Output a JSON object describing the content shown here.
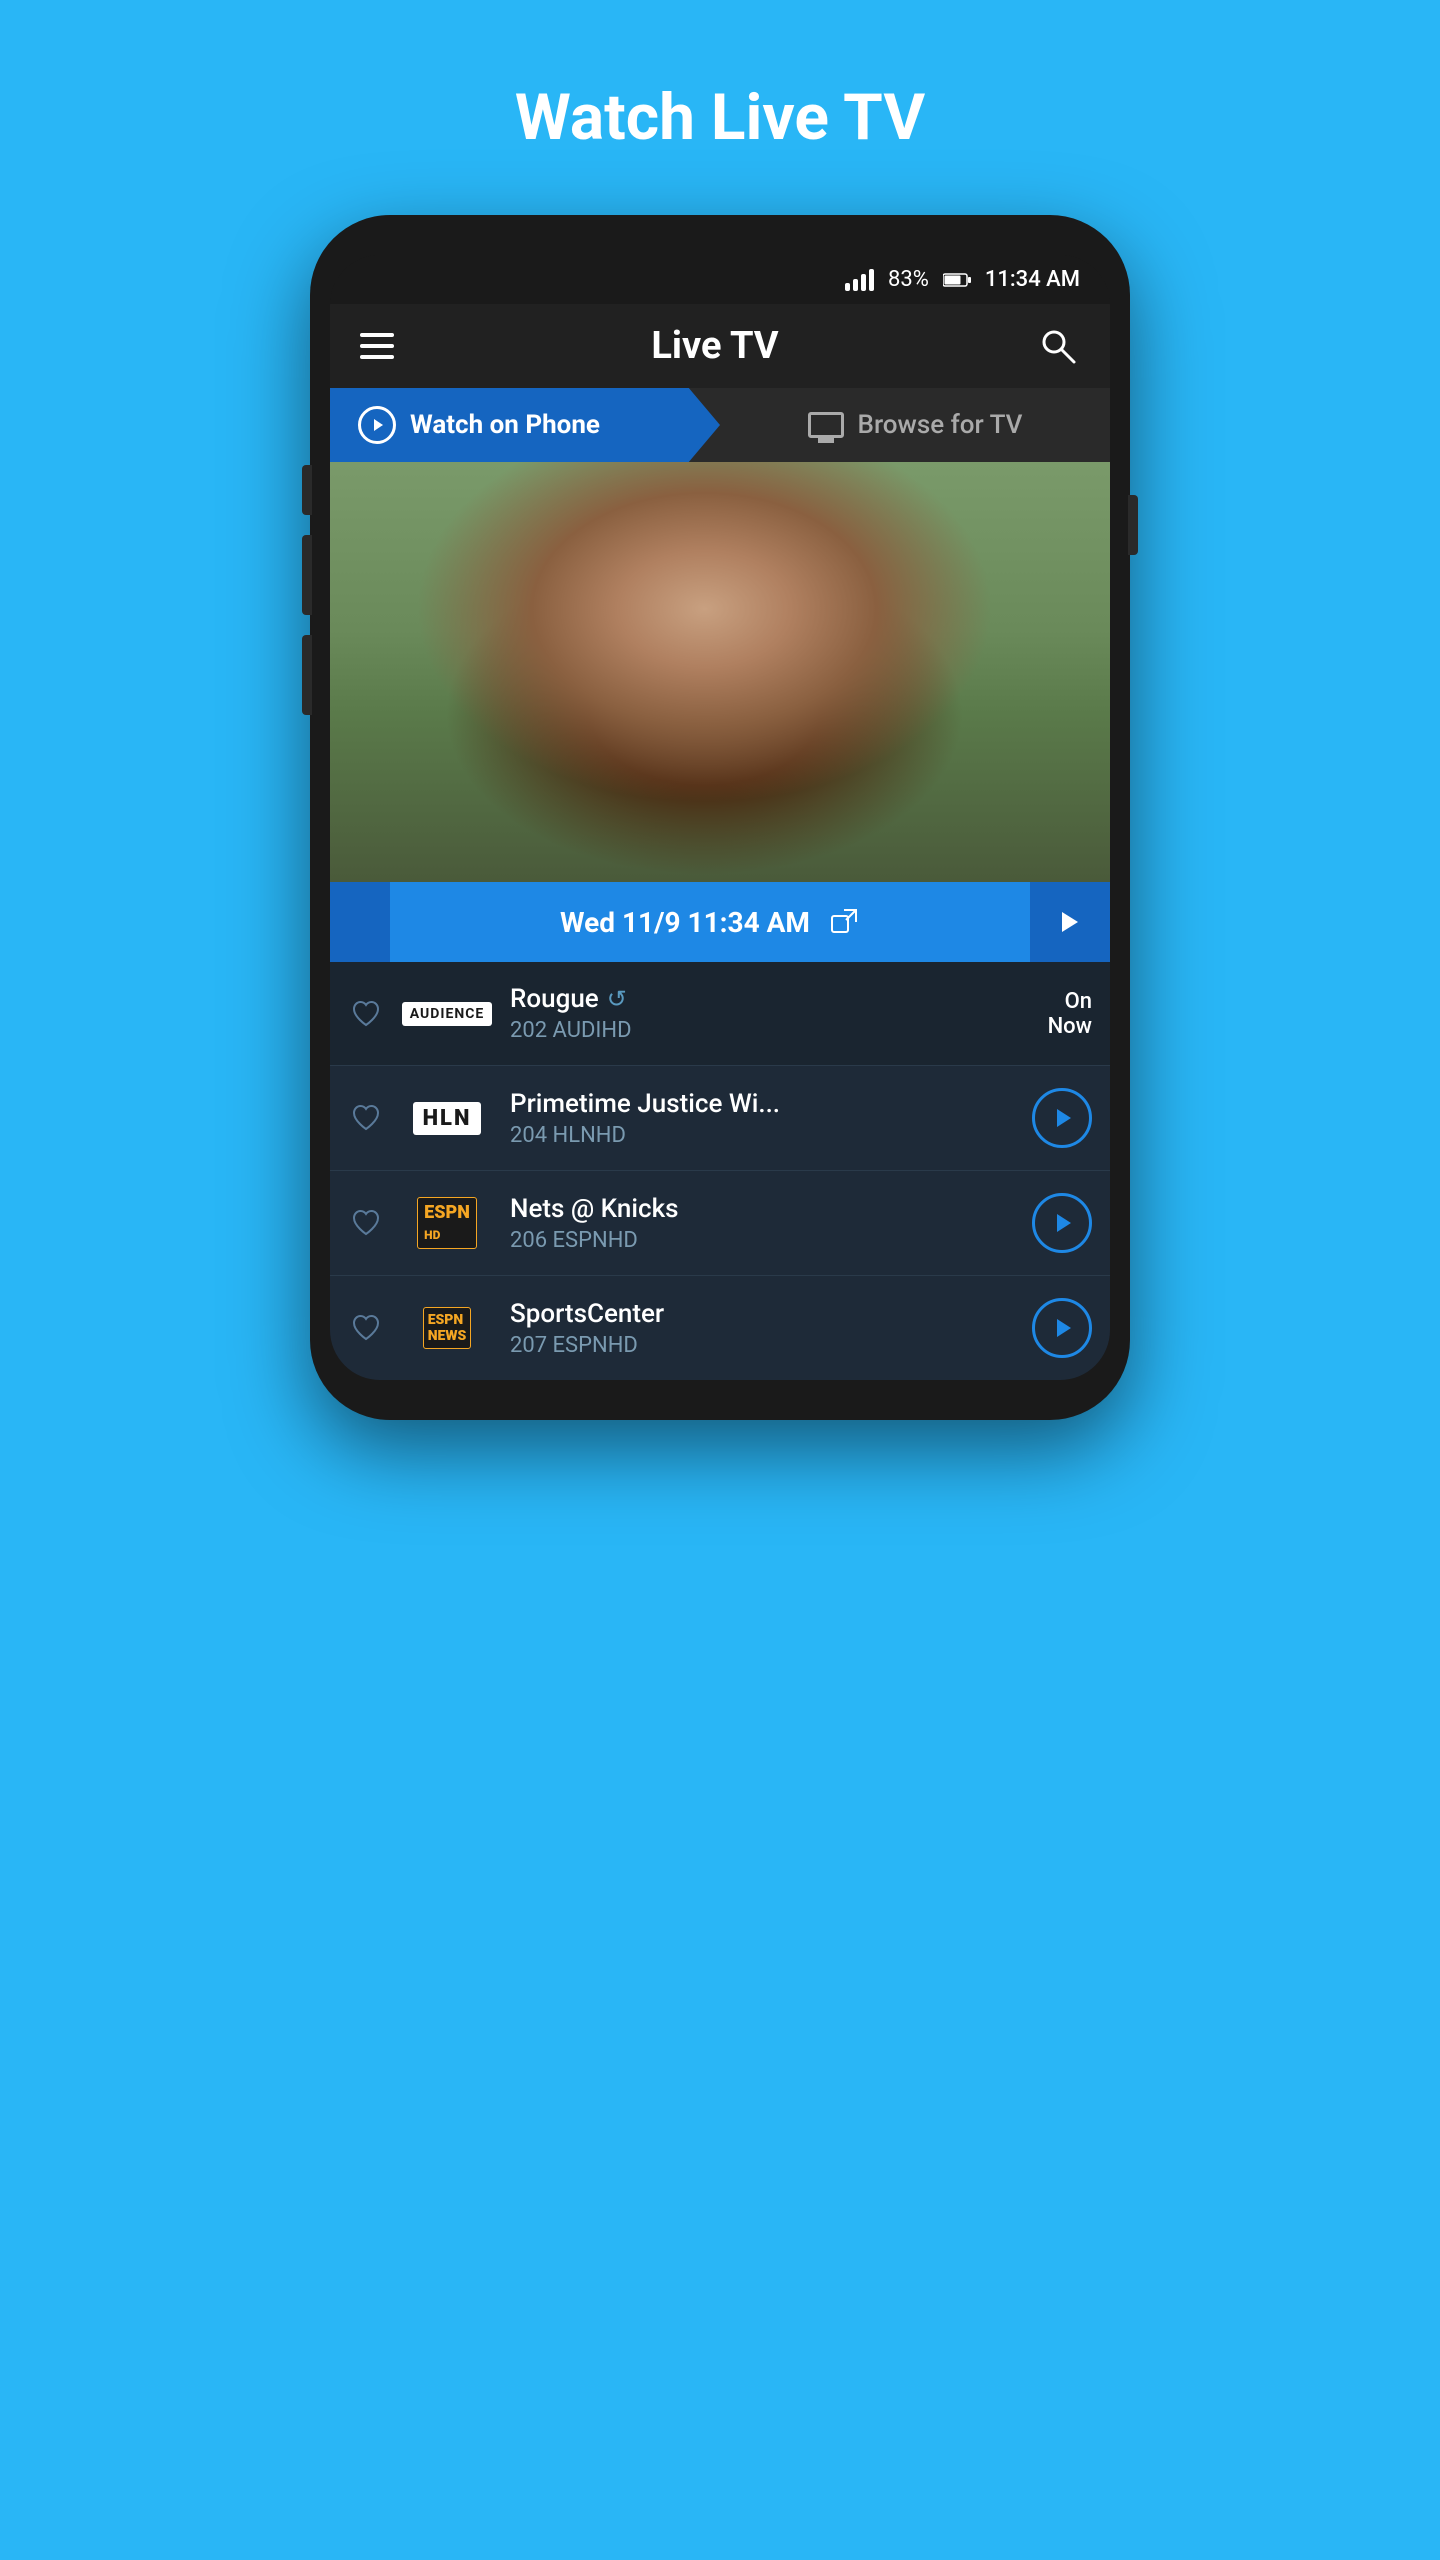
{
  "page": {
    "background_color": "#29B6F6",
    "title": "Watch Live TV"
  },
  "status_bar": {
    "battery": "83%",
    "time": "11:34 AM"
  },
  "app_bar": {
    "title": "Live TV"
  },
  "tabs": {
    "watch_label": "Watch on Phone",
    "browse_label": "Browse for TV"
  },
  "now_bar": {
    "date_time": "Wed 11/9  11:34 AM"
  },
  "channels": [
    {
      "name": "Rougue",
      "number": "202",
      "network_code": "AUDIHD",
      "status": "On Now",
      "logo_type": "audience",
      "logo_text": "AUDIENCE",
      "has_play": false,
      "favorited": false
    },
    {
      "name": "Primetime Justice Wi...",
      "number": "204",
      "network_code": "HLNHD",
      "status": "",
      "logo_type": "hln",
      "logo_text": "HLN",
      "has_play": true,
      "favorited": false
    },
    {
      "name": "Nets @ Knicks",
      "number": "206",
      "network_code": "ESPNHD",
      "status": "",
      "logo_type": "espnhd",
      "logo_text": "ESPNHD",
      "has_play": true,
      "favorited": false
    },
    {
      "name": "SportsCenter",
      "number": "207",
      "network_code": "ESPNHD",
      "status": "",
      "logo_type": "espnnewshd",
      "logo_text": "ESPNNEWS",
      "has_play": true,
      "favorited": false
    }
  ]
}
